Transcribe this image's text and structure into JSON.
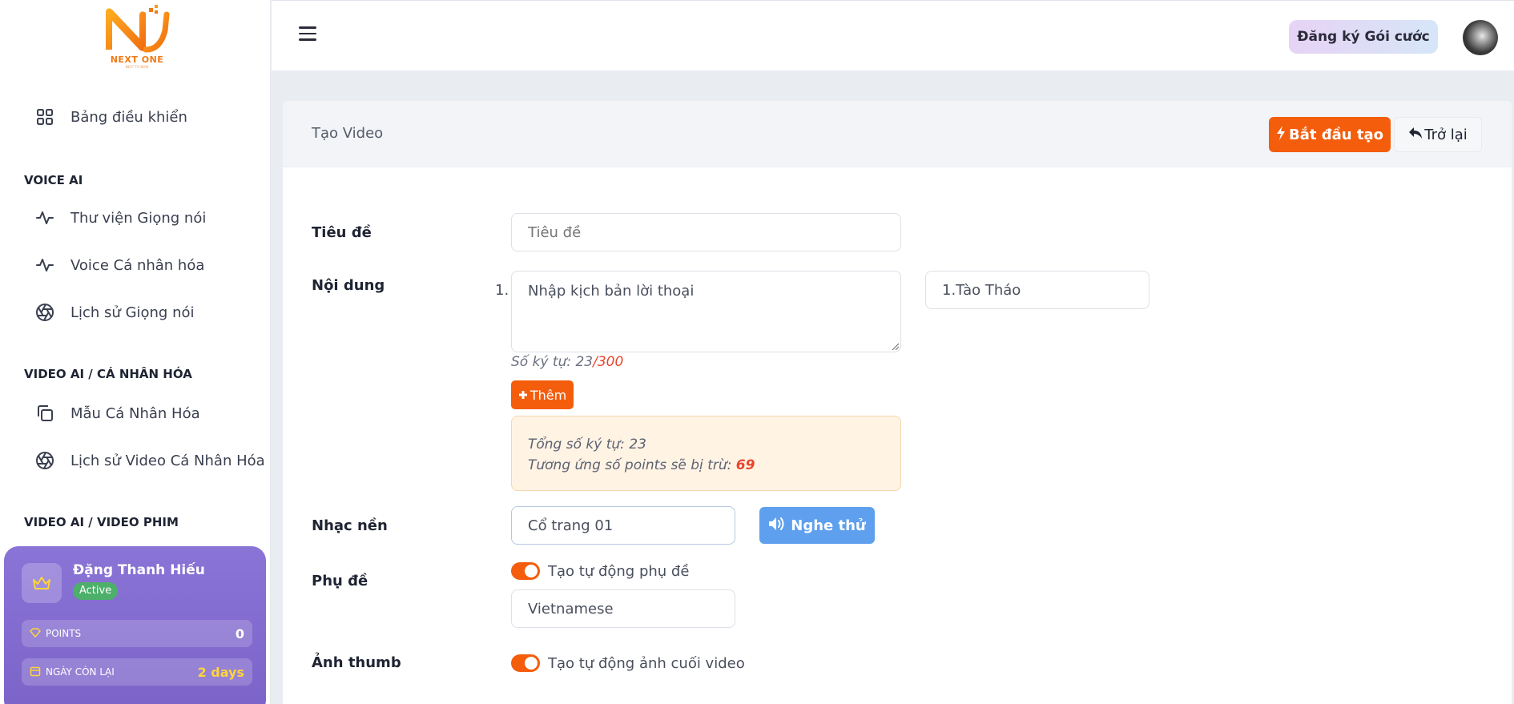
{
  "sidebar": {
    "logo_text": "NEXT ONE",
    "logo_sub": "NEXT TO NOW",
    "dashboard": "Bảng điều khiển",
    "sections": [
      {
        "title": "VOICE AI"
      },
      {
        "title": "VIDEO AI / CÁ NHÂN HÓA"
      },
      {
        "title": "VIDEO AI / VIDEO PHIM"
      }
    ],
    "items": [
      {
        "label": "Thư viện Giọng nói",
        "icon": "activity-icon"
      },
      {
        "label": "Voice Cá nhân hóa",
        "icon": "activity-icon"
      },
      {
        "label": "Lịch sử Giọng nói",
        "icon": "aperture-icon"
      },
      {
        "label": "Mẫu Cá Nhân Hóa",
        "icon": "copy-icon"
      },
      {
        "label": "Lịch sử Video Cá Nhân Hóa",
        "icon": "aperture-icon"
      }
    ]
  },
  "user": {
    "name": "Đặng Thanh Hiếu",
    "status": "Active",
    "points_label": "POINTS",
    "points_value": "0",
    "days_label": "NGÀY CÒN LẠI",
    "days_value": "2 days"
  },
  "topbar": {
    "register_label": "Đăng ký Gói cước"
  },
  "card": {
    "title": "Tạo Video",
    "start_label": "Bắt đầu tạo",
    "back_label": "Trở lại"
  },
  "form": {
    "title_label": "Tiêu đề",
    "title_placeholder": "Tiêu đề",
    "content_label": "Nội dung",
    "line_number": "1.",
    "content_placeholder": "Nhập kịch bản lời thoại",
    "speaker_value": "1.Tào Tháo",
    "char_count_prefix": "Số ký tự: 23",
    "char_count_max": "/300",
    "add_label": "Thêm",
    "summary_total": "Tổng số ký tự: 23",
    "summary_points_prefix": "Tương ứng số points sẽ bị trừ:",
    "summary_points_value": "69",
    "music_label": "Nhạc nền",
    "music_value": "Cổ trang 01",
    "listen_label": "Nghe thử",
    "subtitle_label": "Phụ đề",
    "subtitle_toggle_label": "Tạo tự động phụ đề",
    "subtitle_language": "Vietnamese",
    "thumb_label": "Ảnh thumb",
    "thumb_toggle_label": "Tạo tự động ảnh cuối video"
  },
  "colors": {
    "accent": "#f45d0c",
    "listen": "#5ea0ee",
    "card_purple": "#7b63c8",
    "days_yellow": "#ffd43b"
  }
}
